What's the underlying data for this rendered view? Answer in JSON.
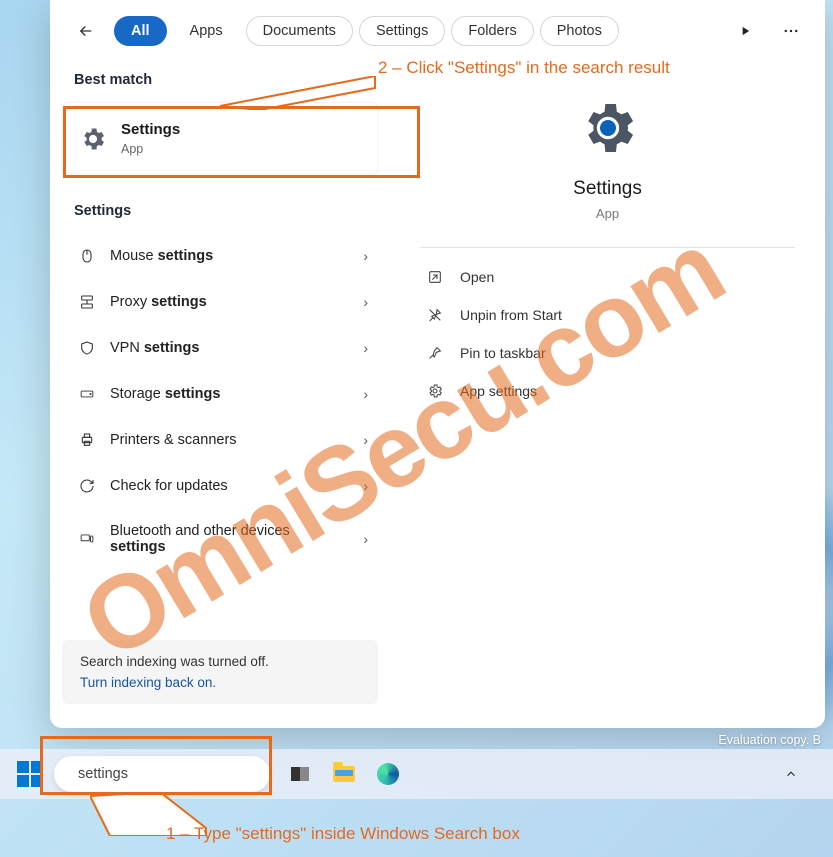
{
  "tabs": {
    "all": "All",
    "apps": "Apps",
    "documents": "Documents",
    "settings": "Settings",
    "folders": "Folders",
    "photos": "Photos"
  },
  "headers": {
    "best_match": "Best match",
    "settings": "Settings"
  },
  "best": {
    "title": "Settings",
    "subtitle": "App"
  },
  "rows": {
    "mouse_pre": "Mouse ",
    "mouse_b": "settings",
    "proxy_pre": "Proxy ",
    "proxy_b": "settings",
    "vpn_pre": "VPN ",
    "vpn_b": "settings",
    "storage_pre": "Storage ",
    "storage_b": "settings",
    "printers": "Printers & scanners",
    "updates": "Check for updates",
    "bt_line1": "Bluetooth and other devices",
    "bt_line2": "settings"
  },
  "notice": {
    "msg": "Search indexing was turned off.",
    "link": "Turn indexing back on."
  },
  "detail": {
    "title": "Settings",
    "subtitle": "App"
  },
  "actions": {
    "open": "Open",
    "unpin": "Unpin from Start",
    "pin_taskbar": "Pin to taskbar",
    "app_settings": "App settings"
  },
  "search": {
    "value": "settings"
  },
  "eval": "Evaluation copy. B",
  "anno": {
    "step1": "1 – Type \"settings\" inside Windows Search box",
    "step2": "2 – Click \"Settings\" in the search result"
  },
  "watermark": "OmniSecu.com"
}
